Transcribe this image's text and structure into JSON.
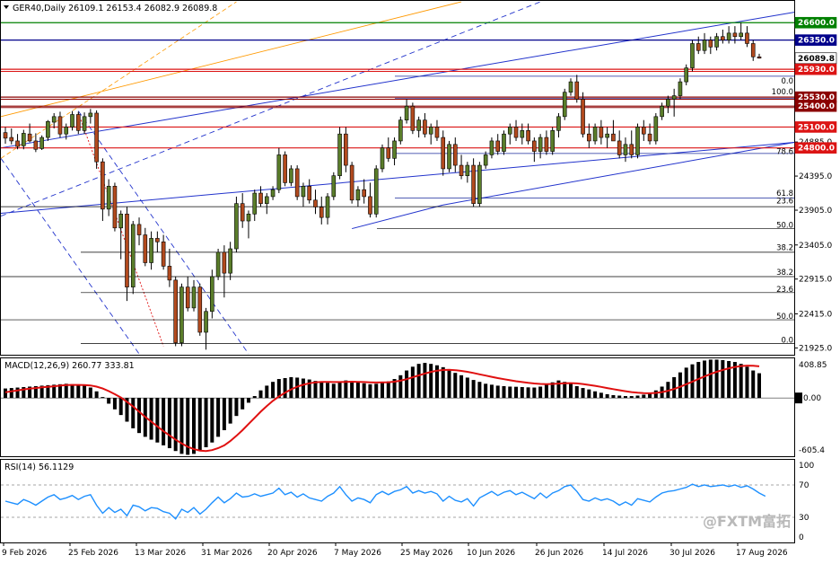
{
  "symbol_header": "GER40,Daily  26109.1 26153.4 26082.9 26089.8",
  "macd_header": "MACD(12,26,9) 260.77 333.81",
  "rsi_header": "RSI(14) 56.1129",
  "watermark": "@FXTM富拓",
  "price_tags": [
    {
      "label": "26600.0",
      "bg": "#008000",
      "fg": "#ffffff",
      "price": 26600
    },
    {
      "label": "26350.0",
      "bg": "#00008b",
      "fg": "#ffffff",
      "price": 26350
    },
    {
      "label": "26089.8",
      "bg": "#ffffff",
      "fg": "#000000",
      "price": 26089.8
    },
    {
      "label": "25930.0",
      "bg": "#dc1414",
      "fg": "#ffffff",
      "price": 25930
    },
    {
      "label": "25530.0",
      "bg": "#8b0000",
      "fg": "#ffffff",
      "price": 25530
    },
    {
      "label": "25400.0",
      "bg": "#8b0000",
      "fg": "#ffffff",
      "price": 25400
    },
    {
      "label": "25100.0",
      "bg": "#dc1414",
      "fg": "#ffffff",
      "price": 25100
    },
    {
      "label": "24800.0",
      "bg": "#dc1414",
      "fg": "#ffffff",
      "price": 24800
    }
  ],
  "price_axis_labels": [
    "24885.0",
    "24395.0",
    "23905.0",
    "23405.0",
    "22915.0",
    "22415.0",
    "21925.0"
  ],
  "macd_axis_labels": [
    "408.85",
    "0.00",
    "-605.4"
  ],
  "rsi_axis_labels": [
    "100",
    "70",
    "30",
    "0"
  ],
  "fib_labels": [
    "0.0",
    "100.0",
    "78.6",
    "61.8",
    "23.6",
    "50.0",
    "38.2",
    "38.2",
    "23.6",
    "50.0",
    "0.0"
  ],
  "date_labels": [
    "9 Feb 2026",
    "25 Feb 2026",
    "13 Mar 2026",
    "31 Mar 2026",
    "20 Apr 2026",
    "7 May 2026",
    "25 May 2026",
    "10 Jun 2026",
    "26 Jun 2026",
    "14 Jul 2026",
    "30 Jul 2026",
    "17 Aug 2026"
  ],
  "colors": {
    "bull": "#5a7d2a",
    "bear": "#b24a1e",
    "macd_signal": "#e01010",
    "rsi_line": "#1e90ff",
    "channel": "#2233cc",
    "fan": "#ff9900"
  },
  "chart_data": {
    "type": "candlestick",
    "symbol": "GER40",
    "timeframe": "Daily",
    "last_bar": {
      "open": 26109.1,
      "high": 26153.4,
      "low": 26082.9,
      "close": 26089.8
    },
    "y_range": [
      21840,
      26900
    ],
    "x_range": [
      "9 Feb 2026",
      "21 Aug 2026"
    ],
    "horizontal_levels": [
      26600,
      26350,
      25930,
      25530,
      25400,
      25100,
      24800
    ],
    "ohlc": [
      [
        25020,
        25100,
        24860,
        24940
      ],
      [
        24950,
        25080,
        24850,
        24900
      ],
      [
        24900,
        25000,
        24780,
        24820
      ],
      [
        24830,
        25060,
        24780,
        25010
      ],
      [
        25000,
        25150,
        24880,
        24900
      ],
      [
        24900,
        25010,
        24740,
        24780
      ],
      [
        24790,
        24980,
        24770,
        24950
      ],
      [
        24950,
        25200,
        24900,
        25180
      ],
      [
        25170,
        25300,
        25080,
        25250
      ],
      [
        25250,
        25320,
        24950,
        25000
      ],
      [
        25000,
        25150,
        24920,
        25100
      ],
      [
        25100,
        25330,
        25050,
        25280
      ],
      [
        25280,
        25320,
        25000,
        25050
      ],
      [
        25050,
        25310,
        25000,
        25250
      ],
      [
        25250,
        25360,
        25150,
        25300
      ],
      [
        25300,
        25340,
        24500,
        24600
      ],
      [
        24600,
        24650,
        23750,
        23920
      ],
      [
        23920,
        24350,
        23820,
        24250
      ],
      [
        24250,
        24300,
        23600,
        23650
      ],
      [
        23650,
        23900,
        23200,
        23850
      ],
      [
        23850,
        23950,
        22600,
        22800
      ],
      [
        22800,
        23750,
        22700,
        23700
      ],
      [
        23700,
        23800,
        23400,
        23550
      ],
      [
        23550,
        23650,
        23100,
        23150
      ],
      [
        23150,
        23600,
        23050,
        23500
      ],
      [
        23500,
        23600,
        23300,
        23450
      ],
      [
        23450,
        23550,
        23050,
        23100
      ],
      [
        23100,
        23350,
        22800,
        22900
      ],
      [
        22900,
        22950,
        21950,
        22000
      ],
      [
        22000,
        22850,
        21950,
        22800
      ],
      [
        22800,
        22950,
        22450,
        22500
      ],
      [
        22500,
        22900,
        22450,
        22800
      ],
      [
        22800,
        22850,
        22100,
        22150
      ],
      [
        22150,
        22500,
        21900,
        22450
      ],
      [
        22450,
        23050,
        22350,
        22950
      ],
      [
        22950,
        23350,
        22900,
        23300
      ],
      [
        23300,
        23400,
        22650,
        23000
      ],
      [
        23000,
        23450,
        22900,
        23350
      ],
      [
        23350,
        24100,
        23300,
        24000
      ],
      [
        24000,
        24150,
        23650,
        23750
      ],
      [
        23750,
        23900,
        23500,
        23850
      ],
      [
        23850,
        24200,
        23750,
        24150
      ],
      [
        24150,
        24250,
        23950,
        24000
      ],
      [
        24000,
        24150,
        23850,
        24100
      ],
      [
        24100,
        24250,
        24050,
        24200
      ],
      [
        24200,
        24800,
        24150,
        24700
      ],
      [
        24700,
        24750,
        24250,
        24300
      ],
      [
        24300,
        24550,
        24250,
        24500
      ],
      [
        24500,
        24550,
        24050,
        24100
      ],
      [
        24100,
        24300,
        23950,
        24250
      ],
      [
        24250,
        24350,
        24000,
        24050
      ],
      [
        24050,
        24200,
        23850,
        23950
      ],
      [
        23950,
        24100,
        23700,
        23800
      ],
      [
        23800,
        24150,
        23700,
        24100
      ],
      [
        24100,
        24450,
        24050,
        24400
      ],
      [
        24400,
        25100,
        24350,
        25000
      ],
      [
        25000,
        25100,
        24450,
        24550
      ],
      [
        24550,
        24600,
        24000,
        24050
      ],
      [
        24050,
        24250,
        23950,
        24200
      ],
      [
        24200,
        24350,
        24000,
        24100
      ],
      [
        24100,
        24300,
        23800,
        23850
      ],
      [
        23850,
        24550,
        23800,
        24500
      ],
      [
        24500,
        24850,
        24450,
        24800
      ],
      [
        24800,
        24950,
        24600,
        24650
      ],
      [
        24650,
        24950,
        24550,
        24900
      ],
      [
        24900,
        25250,
        24850,
        25200
      ],
      [
        25200,
        25500,
        25150,
        25400
      ],
      [
        25400,
        25450,
        25000,
        25050
      ],
      [
        25050,
        25250,
        24950,
        25200
      ],
      [
        25200,
        25300,
        24950,
        25000
      ],
      [
        25000,
        25150,
        24850,
        25100
      ],
      [
        25100,
        25200,
        24900,
        24950
      ],
      [
        24950,
        25050,
        24400,
        24500
      ],
      [
        24500,
        24900,
        24450,
        24850
      ],
      [
        24850,
        24950,
        24450,
        24550
      ],
      [
        24550,
        24700,
        24350,
        24400
      ],
      [
        24400,
        24600,
        24300,
        24550
      ],
      [
        24550,
        24650,
        23950,
        24000
      ],
      [
        24000,
        24600,
        23950,
        24550
      ],
      [
        24550,
        24750,
        24500,
        24700
      ],
      [
        24700,
        24950,
        24650,
        24900
      ],
      [
        24900,
        25000,
        24700,
        24750
      ],
      [
        24750,
        25050,
        24700,
        25000
      ],
      [
        25000,
        25150,
        24850,
        25100
      ],
      [
        25100,
        25200,
        24900,
        24950
      ],
      [
        24950,
        25150,
        24850,
        25050
      ],
      [
        25050,
        25150,
        24850,
        24900
      ],
      [
        24900,
        24950,
        24600,
        24750
      ],
      [
        24750,
        25000,
        24650,
        24950
      ],
      [
        24950,
        25050,
        24700,
        24750
      ],
      [
        24750,
        25100,
        24700,
        25050
      ],
      [
        25050,
        25300,
        24950,
        25250
      ],
      [
        25250,
        25650,
        25200,
        25600
      ],
      [
        25600,
        25800,
        25550,
        25750
      ],
      [
        25750,
        25850,
        25450,
        25500
      ],
      [
        25500,
        25600,
        24950,
        25000
      ],
      [
        25000,
        25150,
        24800,
        24900
      ],
      [
        24900,
        25150,
        24850,
        25100
      ],
      [
        25100,
        25200,
        24850,
        24950
      ],
      [
        24950,
        25100,
        24800,
        25000
      ],
      [
        25000,
        25200,
        24900,
        24900
      ],
      [
        24900,
        25050,
        24650,
        24700
      ],
      [
        24700,
        24950,
        24600,
        24850
      ],
      [
        24850,
        25050,
        24650,
        24700
      ],
      [
        24700,
        25150,
        24650,
        25100
      ],
      [
        25100,
        25200,
        24900,
        25000
      ],
      [
        25000,
        25150,
        24850,
        24900
      ],
      [
        24900,
        25300,
        24850,
        25250
      ],
      [
        25250,
        25450,
        25200,
        25400
      ],
      [
        25400,
        25550,
        25300,
        25500
      ],
      [
        25500,
        25650,
        25250,
        25550
      ],
      [
        25550,
        25800,
        25500,
        25750
      ],
      [
        25750,
        26000,
        25700,
        25950
      ],
      [
        25950,
        26350,
        25900,
        26300
      ],
      [
        26300,
        26400,
        26150,
        26200
      ],
      [
        26200,
        26450,
        26150,
        26350
      ],
      [
        26350,
        26400,
        26150,
        26250
      ],
      [
        26250,
        26450,
        26200,
        26400
      ],
      [
        26400,
        26500,
        26300,
        26350
      ],
      [
        26350,
        26550,
        26300,
        26450
      ],
      [
        26450,
        26550,
        26300,
        26400
      ],
      [
        26400,
        26600,
        26350,
        26450
      ],
      [
        26450,
        26550,
        26250,
        26300
      ],
      [
        26300,
        26350,
        26050,
        26109
      ],
      [
        26109.1,
        26153.4,
        26082.9,
        26089.8
      ]
    ],
    "macd": {
      "y_range": [
        -605.4,
        408.85
      ],
      "histogram": [
        100,
        105,
        110,
        115,
        120,
        125,
        130,
        135,
        140,
        145,
        150,
        145,
        140,
        130,
        110,
        70,
        10,
        -60,
        -120,
        -180,
        -250,
        -320,
        -370,
        -410,
        -440,
        -470,
        -500,
        -530,
        -560,
        -590,
        -600,
        -590,
        -560,
        -520,
        -470,
        -410,
        -340,
        -270,
        -190,
        -120,
        -50,
        20,
        80,
        130,
        170,
        200,
        210,
        220,
        215,
        205,
        195,
        180,
        170,
        160,
        150,
        175,
        185,
        175,
        165,
        155,
        145,
        150,
        160,
        175,
        200,
        240,
        290,
        330,
        360,
        370,
        360,
        345,
        325,
        295,
        265,
        240,
        215,
        190,
        170,
        150,
        140,
        130,
        125,
        120,
        118,
        115,
        112,
        110,
        120,
        140,
        165,
        185,
        170,
        150,
        125,
        105,
        90,
        70,
        55,
        40,
        30,
        25,
        20,
        20,
        25,
        35,
        50,
        80,
        120,
        170,
        220,
        270,
        320,
        355,
        380,
        395,
        405,
        405,
        400,
        390,
        380,
        360,
        330,
        290,
        261
      ],
      "signal": [
        60,
        70,
        80,
        90,
        98,
        105,
        112,
        118,
        124,
        130,
        136,
        138,
        138,
        137,
        132,
        120,
        100,
        72,
        40,
        5,
        -40,
        -90,
        -145,
        -200,
        -250,
        -300,
        -350,
        -395,
        -440,
        -480,
        -515,
        -540,
        -555,
        -560,
        -550,
        -530,
        -500,
        -455,
        -400,
        -340,
        -275,
        -210,
        -145,
        -85,
        -30,
        15,
        55,
        90,
        120,
        140,
        155,
        165,
        170,
        170,
        168,
        168,
        170,
        172,
        170,
        168,
        165,
        163,
        164,
        166,
        172,
        182,
        198,
        218,
        238,
        258,
        275,
        288,
        295,
        297,
        293,
        286,
        276,
        264,
        250,
        236,
        223,
        210,
        198,
        187,
        177,
        168,
        160,
        153,
        148,
        146,
        148,
        152,
        156,
        157,
        154,
        147,
        138,
        128,
        117,
        105,
        93,
        82,
        71,
        62,
        55,
        51,
        50,
        53,
        62,
        76,
        95,
        118,
        145,
        172,
        200,
        227,
        253,
        276,
        296,
        313,
        327,
        337,
        342,
        340,
        334
      ]
    },
    "rsi": {
      "y_range": [
        0,
        100
      ],
      "levels": [
        70,
        30
      ],
      "values": [
        50,
        48,
        46,
        52,
        49,
        45,
        50,
        55,
        58,
        52,
        54,
        57,
        52,
        56,
        58,
        45,
        35,
        42,
        36,
        40,
        32,
        45,
        43,
        38,
        42,
        41,
        37,
        35,
        28,
        40,
        36,
        42,
        34,
        40,
        48,
        55,
        48,
        53,
        60,
        55,
        56,
        59,
        56,
        58,
        60,
        66,
        58,
        61,
        55,
        59,
        54,
        52,
        50,
        56,
        60,
        68,
        58,
        50,
        54,
        52,
        48,
        58,
        62,
        58,
        62,
        64,
        68,
        60,
        63,
        60,
        62,
        59,
        50,
        56,
        51,
        49,
        53,
        44,
        54,
        58,
        62,
        57,
        61,
        63,
        58,
        61,
        57,
        53,
        60,
        54,
        60,
        63,
        68,
        70,
        62,
        52,
        50,
        54,
        51,
        53,
        50,
        45,
        49,
        45,
        53,
        51,
        49,
        55,
        60,
        62,
        63,
        65,
        67,
        71,
        68,
        70,
        68,
        69,
        70,
        68,
        70,
        67,
        69,
        65,
        60,
        56.1
      ]
    }
  }
}
